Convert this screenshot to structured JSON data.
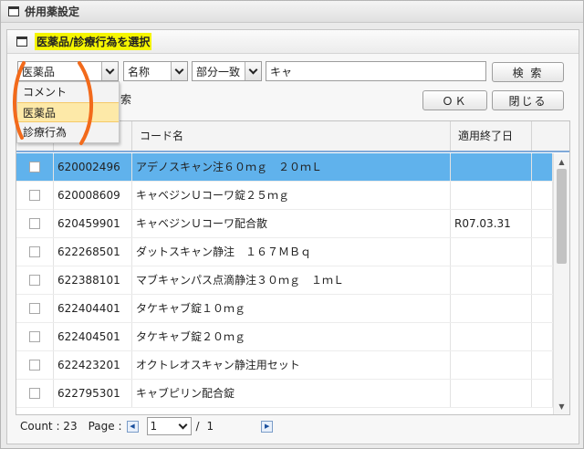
{
  "window": {
    "title": "併用薬設定"
  },
  "panel": {
    "title": "医薬品/診療行為を選択"
  },
  "search": {
    "category_value": "医薬品",
    "field_value": "名称",
    "match_value": "部分一致",
    "keyword": "キャ",
    "search_button": "検 索",
    "ok_button": "ＯＫ",
    "close_button": "閉じる",
    "partial_label": "索"
  },
  "dropdown": {
    "options": [
      {
        "label": "コメント",
        "selected": false
      },
      {
        "label": "医薬品",
        "selected": true
      },
      {
        "label": "診療行為",
        "selected": false
      }
    ]
  },
  "grid": {
    "columns": [
      "",
      "",
      "コード名",
      "適用終了日"
    ],
    "rows": [
      {
        "code": "620002496",
        "name": "アデノスキャン注６０ｍｇ　２０ｍＬ",
        "end_date": "",
        "selected": true
      },
      {
        "code": "620008609",
        "name": "キャベジンＵコーワ錠２５ｍｇ",
        "end_date": "",
        "selected": false
      },
      {
        "code": "620459901",
        "name": "キャベジンＵコーワ配合散",
        "end_date": "R07.03.31",
        "selected": false
      },
      {
        "code": "622268501",
        "name": "ダットスキャン静注　１６７ＭＢｑ",
        "end_date": "",
        "selected": false
      },
      {
        "code": "622388101",
        "name": "マブキャンパス点滴静注３０ｍｇ　１ｍＬ",
        "end_date": "",
        "selected": false
      },
      {
        "code": "622404401",
        "name": "タケキャブ錠１０ｍｇ",
        "end_date": "",
        "selected": false
      },
      {
        "code": "622404501",
        "name": "タケキャブ錠２０ｍｇ",
        "end_date": "",
        "selected": false
      },
      {
        "code": "622423201",
        "name": "オクトレオスキャン静注用セット",
        "end_date": "",
        "selected": false
      },
      {
        "code": "622795301",
        "name": "キャブピリン配合錠",
        "end_date": "",
        "selected": false
      }
    ]
  },
  "footer": {
    "count_label": "Count : 23",
    "page_label": "Page :",
    "current_page": "1",
    "separator": "/",
    "total_pages": "1"
  },
  "colors": {
    "selected_row": "#60b2ec",
    "highlight": "#f5f500",
    "annotation": "#f26a1b",
    "dropdown_selected": "#fde9a8"
  }
}
